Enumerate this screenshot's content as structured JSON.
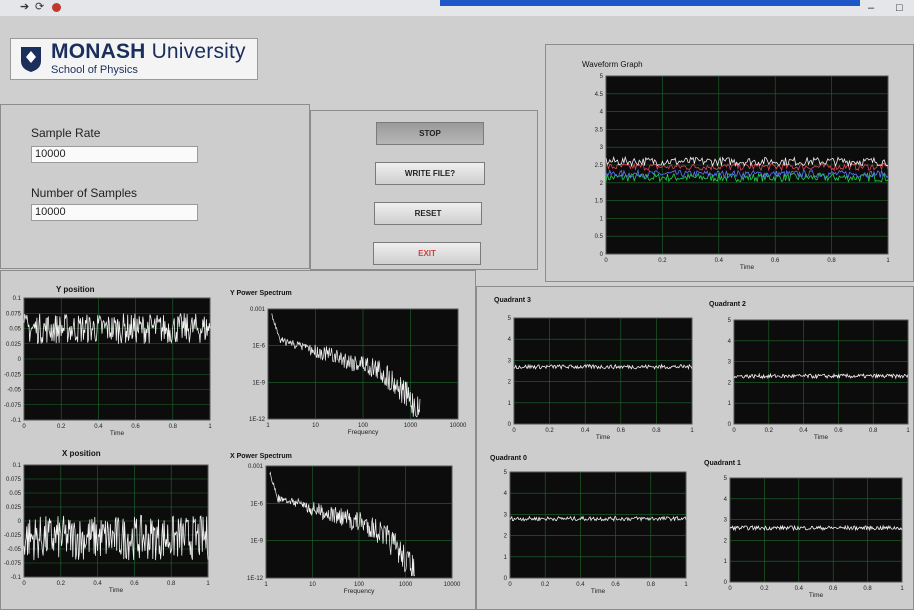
{
  "window": {
    "maximize_glyph": "□",
    "minimize_glyph": "–",
    "toolbar_icons": [
      "run-arrow-icon",
      "run-continuously-icon",
      "abort-icon"
    ]
  },
  "logo": {
    "brand_bold": "MONASH",
    "brand_rest": " University",
    "subtitle": "School of Physics"
  },
  "controls": {
    "sample_rate_label": "Sample Rate",
    "sample_rate_value": "10000",
    "num_samples_label": "Number of Samples",
    "num_samples_value": "10000"
  },
  "buttons": {
    "stop": "STOP",
    "write_file": "WRITE FILE?",
    "reset": "RESET",
    "exit": "EXIT"
  },
  "colors": {
    "plot_bg": "#0c0c0c",
    "grid": "#1f6a2c",
    "trace_white": "#f2f2f2",
    "trace_red": "#e0465a",
    "trace_blue": "#5a78ff",
    "trace_green": "#22d24a",
    "exit_text": "#d04040"
  },
  "graphs": {
    "waveform": {
      "title": "Waveform Graph",
      "xlabel": "Time",
      "yticks": [
        "5",
        "4.5",
        "4",
        "3.5",
        "3",
        "2.5",
        "2",
        "1.5",
        "1",
        "0.5",
        "0"
      ],
      "xticks": [
        "0",
        "0.2",
        "0.4",
        "0.6",
        "0.8",
        "1"
      ],
      "levels": {
        "white": 2.6,
        "red": 2.45,
        "blue": 2.25,
        "green": 2.15
      }
    },
    "y_position": {
      "title": "Y position",
      "xlabel": "Time",
      "yticks": [
        "0.1",
        "0.075",
        "0.05",
        "0.025",
        "0",
        "-0.025",
        "-0.05",
        "-0.075",
        "-0.1"
      ],
      "xticks": [
        "0",
        "0.2",
        "0.4",
        "0.6",
        "0.8",
        "1"
      ],
      "center": 0.05,
      "noise": 0.025
    },
    "x_position": {
      "title": "X position",
      "xlabel": "Time",
      "yticks": [
        "0.1",
        "0.075",
        "0.05",
        "0.025",
        "0",
        "-0.025",
        "-0.05",
        "-0.075",
        "-0.1"
      ],
      "xticks": [
        "0",
        "0.2",
        "0.4",
        "0.6",
        "0.8",
        "1"
      ],
      "center": -0.03,
      "noise": 0.04
    },
    "y_power_spectrum": {
      "title": "Y Power Spectrum",
      "xlabel": "Frequency",
      "yticks": [
        "0.001",
        "1E-6",
        "1E-9",
        "1E-12"
      ],
      "xticks": [
        "1",
        "10",
        "100",
        "1000",
        "10000"
      ]
    },
    "x_power_spectrum": {
      "title": "X Power Spectrum",
      "xlabel": "Frequency",
      "yticks": [
        "0.001",
        "1E-6",
        "1E-9",
        "1E-12"
      ],
      "xticks": [
        "1",
        "10",
        "100",
        "1000",
        "10000"
      ]
    },
    "quadrant_3": {
      "title": "Quadrant 3",
      "xlabel": "Time",
      "yticks": [
        "5",
        "4",
        "3",
        "2",
        "1",
        "0"
      ],
      "xticks": [
        "0",
        "0.2",
        "0.4",
        "0.6",
        "0.8",
        "1"
      ],
      "level": 2.7
    },
    "quadrant_2": {
      "title": "Quadrant 2",
      "xlabel": "Time",
      "yticks": [
        "5",
        "4",
        "3",
        "2",
        "1",
        "0"
      ],
      "xticks": [
        "0",
        "0.2",
        "0.4",
        "0.6",
        "0.8",
        "1"
      ],
      "level": 2.3
    },
    "quadrant_0": {
      "title": "Quadrant 0",
      "xlabel": "Time",
      "yticks": [
        "5",
        "4",
        "3",
        "2",
        "1",
        "0"
      ],
      "xticks": [
        "0",
        "0.2",
        "0.4",
        "0.6",
        "0.8",
        "1"
      ],
      "level": 2.8
    },
    "quadrant_1": {
      "title": "Quadrant 1",
      "xlabel": "Time",
      "yticks": [
        "5",
        "4",
        "3",
        "2",
        "1",
        "0"
      ],
      "xticks": [
        "0",
        "0.2",
        "0.4",
        "0.6",
        "0.8",
        "1"
      ],
      "level": 2.6
    }
  }
}
